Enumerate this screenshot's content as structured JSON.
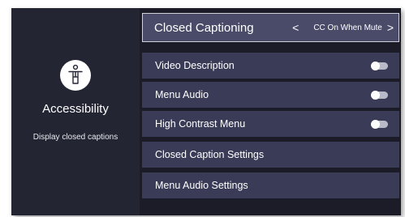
{
  "left_panel": {
    "title": "Accessibility",
    "subtitle": "Display closed captions",
    "icon": "accessibility-person-icon"
  },
  "menu": {
    "closed_captioning": {
      "label": "Closed Captioning",
      "value": "CC On When Mute",
      "prev_glyph": "<",
      "next_glyph": ">"
    },
    "items": [
      {
        "label": "Video Description",
        "toggle": "off"
      },
      {
        "label": "Menu Audio",
        "toggle": "off"
      },
      {
        "label": "High Contrast Menu",
        "toggle": "off"
      },
      {
        "label": "Closed Caption Settings"
      },
      {
        "label": "Menu Audio Settings"
      }
    ]
  },
  "colors": {
    "panel_bg": "#232533",
    "menu_bg": "#1b1c28",
    "row_bg": "#3a3b57",
    "focused_row_bg": "#4a4b69",
    "toggle_off": "#b9bac8"
  }
}
